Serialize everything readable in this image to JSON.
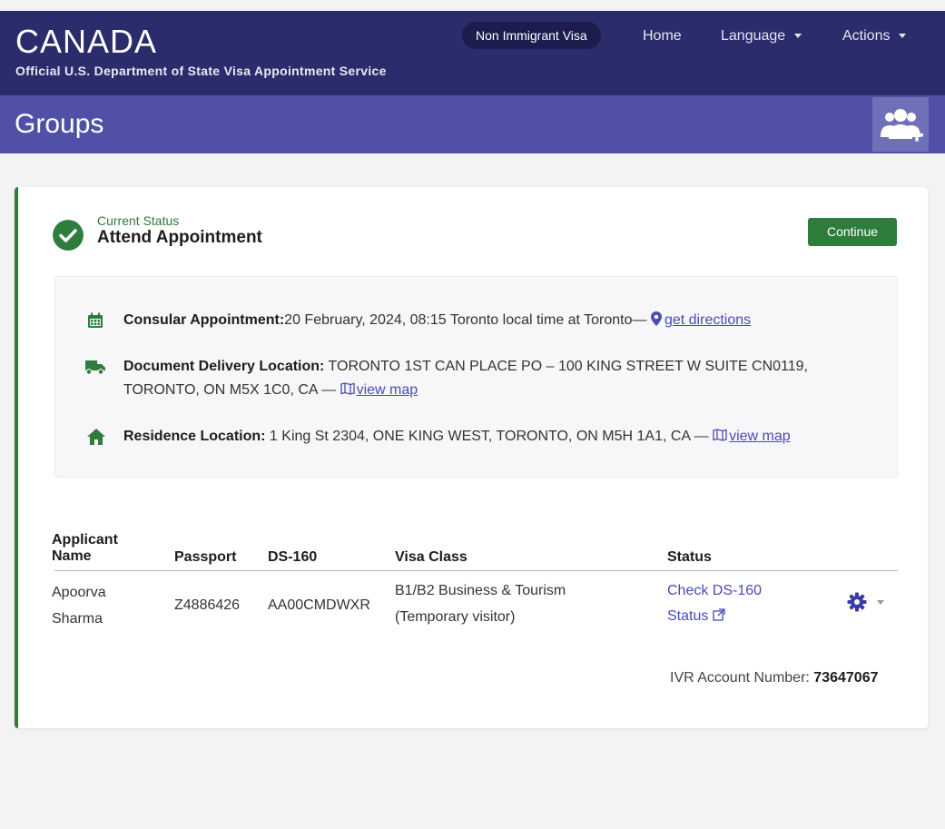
{
  "header": {
    "brand": "CANADA",
    "subtitle": "Official U.S. Department of State Visa Appointment Service",
    "nav_pill": "Non Immigrant Visa",
    "nav_home": "Home",
    "nav_language": "Language",
    "nav_actions": "Actions"
  },
  "page": {
    "title": "Groups",
    "add_group_icon": "group-add-icon"
  },
  "status": {
    "label": "Current Status",
    "value": "Attend Appointment",
    "continue_label": "Continue"
  },
  "details": {
    "consular_label": "Consular Appointment:",
    "consular_value": "20 February, 2024, 08:15 Toronto local time at Toronto— ",
    "consular_link": "get directions",
    "delivery_label": "Document Delivery Location:",
    "delivery_value": " TORONTO 1ST CAN PLACE PO – 100 KING STREET W SUITE CN0119, TORONTO, ON M5X 1C0, CA — ",
    "delivery_link": "view map",
    "residence_label": "Residence Location:",
    "residence_value": " 1 King St 2304, ONE KING WEST, TORONTO, ON M5H 1A1, CA — ",
    "residence_link": "view map"
  },
  "table": {
    "headers": {
      "applicant": "Applicant Name",
      "passport": "Passport",
      "ds160": "DS-160",
      "visa_class": "Visa Class",
      "status": "Status"
    },
    "rows": [
      {
        "name_first": "Apoorva",
        "name_last": "Sharma",
        "passport": "Z4886426",
        "ds160": "AA00CMDWXR",
        "visa_class_line1": "B1/B2 Business & Tourism",
        "visa_class_line2": "(Temporary visitor)",
        "status_line1": "Check DS-160",
        "status_line2": "Status"
      }
    ]
  },
  "ivr": {
    "label": "IVR Account Number: ",
    "value": "73647067"
  },
  "colors": {
    "navbar": "#2a2c6b",
    "subheader": "#5051a6",
    "accent_green": "#2e7d3c",
    "link": "#4a4ab8"
  }
}
